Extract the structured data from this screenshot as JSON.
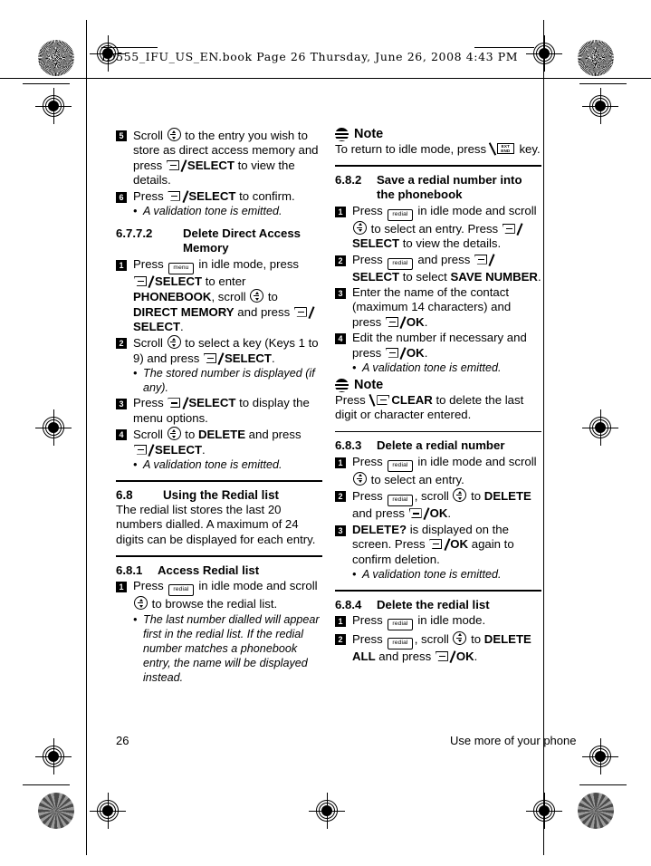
{
  "header": {
    "file_line": "ID555_IFU_US_EN.book  Page 26  Thursday, June 26, 2008  4:43 PM"
  },
  "footer": {
    "page_number": "26",
    "section_title": "Use more of your phone"
  },
  "icons": {
    "scroll": "scroll-updown-icon",
    "softkey_select": "softkey-icon",
    "menu_key": "menu",
    "redial_key": "redial",
    "end_key_line1": "EXT",
    "end_key_line2": "END",
    "note": "note-icon"
  },
  "left_column": {
    "steps_continued": [
      {
        "num": "5",
        "parts": [
          {
            "t": "text",
            "v": "Scroll "
          },
          {
            "t": "scroll"
          },
          {
            "t": "text",
            "v": " to the entry you wish to store as direct access memory and press "
          },
          {
            "t": "softkey"
          },
          {
            "t": "bold",
            "v": "SELECT"
          },
          {
            "t": "text",
            "v": " to view the details."
          }
        ]
      },
      {
        "num": "6",
        "parts": [
          {
            "t": "text",
            "v": "Press "
          },
          {
            "t": "softkey"
          },
          {
            "t": "bold",
            "v": "SELECT"
          },
          {
            "t": "text",
            "v": " to confirm."
          }
        ],
        "bullets": [
          "A validation tone is emitted."
        ]
      }
    ],
    "heading_6772": {
      "number": "6.7.7.2",
      "title": "Delete Direct Access Memory"
    },
    "steps_6772": [
      {
        "num": "1",
        "parts": [
          {
            "t": "text",
            "v": "Press "
          },
          {
            "t": "key",
            "v": "menu"
          },
          {
            "t": "text",
            "v": " in idle mode, press "
          },
          {
            "t": "softkey"
          },
          {
            "t": "bold",
            "v": "SELECT"
          },
          {
            "t": "text",
            "v": " to enter "
          },
          {
            "t": "bold",
            "v": "PHONEBOOK"
          },
          {
            "t": "text",
            "v": ", scroll "
          },
          {
            "t": "scroll"
          },
          {
            "t": "text",
            "v": " to "
          },
          {
            "t": "bold",
            "v": "DIRECT MEMORY"
          },
          {
            "t": "text",
            "v": " and press "
          },
          {
            "t": "softkey"
          },
          {
            "t": "bold",
            "v": "SELECT"
          },
          {
            "t": "text",
            "v": "."
          }
        ]
      },
      {
        "num": "2",
        "parts": [
          {
            "t": "text",
            "v": "Scroll "
          },
          {
            "t": "scroll"
          },
          {
            "t": "text",
            "v": " to select a key (Keys 1 to 9) and press "
          },
          {
            "t": "softkey"
          },
          {
            "t": "bold",
            "v": "SELECT"
          },
          {
            "t": "text",
            "v": "."
          }
        ],
        "bullets": [
          "The stored number is displayed (if any)."
        ]
      },
      {
        "num": "3",
        "parts": [
          {
            "t": "text",
            "v": "Press "
          },
          {
            "t": "softkey"
          },
          {
            "t": "bold",
            "v": "SELECT"
          },
          {
            "t": "text",
            "v": " to display the menu options."
          }
        ]
      },
      {
        "num": "4",
        "parts": [
          {
            "t": "text",
            "v": "Scroll "
          },
          {
            "t": "scroll"
          },
          {
            "t": "text",
            "v": " to "
          },
          {
            "t": "bold",
            "v": "DELETE"
          },
          {
            "t": "text",
            "v": " and press "
          },
          {
            "t": "softkey"
          },
          {
            "t": "bold",
            "v": "SELECT"
          },
          {
            "t": "text",
            "v": "."
          }
        ],
        "bullets": [
          "A validation tone is emitted."
        ]
      }
    ],
    "heading_68": {
      "number": "6.8",
      "title": "Using the Redial list"
    },
    "intro_68": "The redial list stores the last 20 numbers dialled. A maximum of 24 digits can be displayed for each entry.",
    "heading_681": {
      "number": "6.8.1",
      "title": "Access Redial list"
    },
    "steps_681": [
      {
        "num": "1",
        "parts": [
          {
            "t": "text",
            "v": "Press "
          },
          {
            "t": "key",
            "v": "redial"
          },
          {
            "t": "text",
            "v": " in idle mode and scroll "
          },
          {
            "t": "scroll"
          },
          {
            "t": "text",
            "v": " to browse the redial list."
          }
        ],
        "bullets": [
          "The last number dialled will appear first in the redial list. If the redial number matches a phonebook entry, the name will be displayed instead."
        ]
      }
    ]
  },
  "right_column": {
    "note_top": {
      "title": "Note",
      "parts": [
        {
          "t": "text",
          "v": "To return to idle mode, press "
        },
        {
          "t": "endkey"
        },
        {
          "t": "text",
          "v": " key."
        }
      ]
    },
    "heading_682": {
      "number": "6.8.2",
      "title": "Save a redial number into the phonebook"
    },
    "steps_682": [
      {
        "num": "1",
        "parts": [
          {
            "t": "text",
            "v": "Press "
          },
          {
            "t": "key",
            "v": "redial"
          },
          {
            "t": "text",
            "v": " in idle mode and scroll "
          },
          {
            "t": "scroll"
          },
          {
            "t": "text",
            "v": " to select an entry. Press "
          },
          {
            "t": "softkey"
          },
          {
            "t": "bold",
            "v": "SELECT"
          },
          {
            "t": "text",
            "v": " to view the details."
          }
        ]
      },
      {
        "num": "2",
        "parts": [
          {
            "t": "text",
            "v": "Press "
          },
          {
            "t": "key",
            "v": "redial"
          },
          {
            "t": "text",
            "v": " and press "
          },
          {
            "t": "softkey"
          },
          {
            "t": "bold",
            "v": "SELECT"
          },
          {
            "t": "text",
            "v": " to select "
          },
          {
            "t": "bold",
            "v": "SAVE NUMBER"
          },
          {
            "t": "text",
            "v": "."
          }
        ]
      },
      {
        "num": "3",
        "parts": [
          {
            "t": "text",
            "v": "Enter the name of the contact (maximum 14 characters) and press "
          },
          {
            "t": "softkey"
          },
          {
            "t": "bold",
            "v": "OK"
          },
          {
            "t": "text",
            "v": "."
          }
        ]
      },
      {
        "num": "4",
        "parts": [
          {
            "t": "text",
            "v": "Edit the number if necessary and press "
          },
          {
            "t": "softkey"
          },
          {
            "t": "bold",
            "v": "OK"
          },
          {
            "t": "text",
            "v": "."
          }
        ],
        "bullets": [
          "A validation tone is emitted."
        ]
      }
    ],
    "note_mid": {
      "title": "Note",
      "parts": [
        {
          "t": "text",
          "v": "Press "
        },
        {
          "t": "softkeyleft"
        },
        {
          "t": "bold",
          "v": "CLEAR"
        },
        {
          "t": "text",
          "v": " to delete the last digit or character entered."
        }
      ]
    },
    "heading_683": {
      "number": "6.8.3",
      "title": "Delete a redial number"
    },
    "steps_683": [
      {
        "num": "1",
        "parts": [
          {
            "t": "text",
            "v": "Press "
          },
          {
            "t": "key",
            "v": "redial"
          },
          {
            "t": "text",
            "v": " in idle mode and scroll "
          },
          {
            "t": "scroll"
          },
          {
            "t": "text",
            "v": " to select an entry."
          }
        ]
      },
      {
        "num": "2",
        "parts": [
          {
            "t": "text",
            "v": "Press "
          },
          {
            "t": "key",
            "v": "redial"
          },
          {
            "t": "text",
            "v": ", scroll "
          },
          {
            "t": "scroll"
          },
          {
            "t": "text",
            "v": " to "
          },
          {
            "t": "bold",
            "v": "DELETE"
          },
          {
            "t": "text",
            "v": " and press "
          },
          {
            "t": "softkey"
          },
          {
            "t": "bold",
            "v": "OK"
          },
          {
            "t": "text",
            "v": "."
          }
        ]
      },
      {
        "num": "3",
        "parts": [
          {
            "t": "bold",
            "v": "DELETE?"
          },
          {
            "t": "text",
            "v": " is displayed on the screen. Press "
          },
          {
            "t": "softkey"
          },
          {
            "t": "bold",
            "v": "OK"
          },
          {
            "t": "text",
            "v": " again to confirm deletion."
          }
        ],
        "bullets": [
          "A validation tone is emitted."
        ]
      }
    ],
    "heading_684": {
      "number": "6.8.4",
      "title": "Delete the redial list"
    },
    "steps_684": [
      {
        "num": "1",
        "parts": [
          {
            "t": "text",
            "v": "Press "
          },
          {
            "t": "key",
            "v": "redial"
          },
          {
            "t": "text",
            "v": " in idle mode."
          }
        ]
      },
      {
        "num": "2",
        "parts": [
          {
            "t": "text",
            "v": "Press "
          },
          {
            "t": "key",
            "v": "redial"
          },
          {
            "t": "text",
            "v": ", scroll "
          },
          {
            "t": "scroll"
          },
          {
            "t": "text",
            "v": " to "
          },
          {
            "t": "bold",
            "v": "DELETE ALL"
          },
          {
            "t": "text",
            "v": " and press "
          },
          {
            "t": "softkey"
          },
          {
            "t": "bold",
            "v": "OK"
          },
          {
            "t": "text",
            "v": "."
          }
        ]
      }
    ]
  }
}
